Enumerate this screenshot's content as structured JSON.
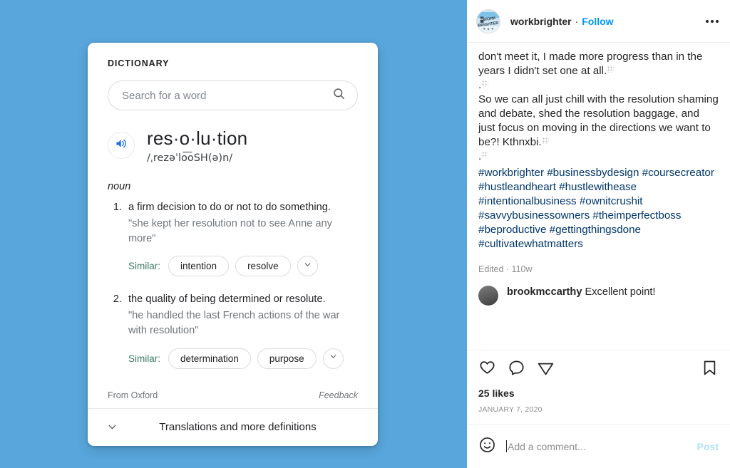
{
  "dictionary": {
    "label": "DICTIONARY",
    "search": {
      "placeholder": "Search for a word",
      "icon": "search-icon",
      "value": ""
    },
    "speaker_icon": "speaker-icon",
    "headword": "res·o·lu·tion",
    "phonetic": "/ˌrezəˈlo͞oSH(ə)n/",
    "part_of_speech": "noun",
    "senses": [
      {
        "number": "1.",
        "definition": "a firm decision to do or not to do something.",
        "example": "\"she kept her resolution not to see Anne any more\"",
        "similar_label": "Similar:",
        "similar": [
          "intention",
          "resolve"
        ],
        "expand_icon": "chevron-down-icon"
      },
      {
        "number": "2.",
        "definition": "the quality of being determined or resolute.",
        "example": "\"he handled the last French actions of the war with resolution\"",
        "similar_label": "Similar:",
        "similar": [
          "determination",
          "purpose"
        ],
        "expand_icon": "chevron-down-icon"
      }
    ],
    "source": "From Oxford",
    "feedback": "Feedback",
    "translations_label": "Translations and more definitions",
    "translations_icon": "chevron-down-icon"
  },
  "instagram": {
    "header": {
      "avatar_alt": "workbrighter",
      "avatar_line1": "WORK",
      "avatar_line2": "BRIGHTER",
      "username": "workbrighter",
      "separator": "·",
      "follow_label": "Follow",
      "more_icon": "ellipsis-icon"
    },
    "caption": {
      "paragraph_1": "don't meet it, I made more progress than in the years I didn't set one at all.",
      "paragraph_2": ".",
      "paragraph_3": "So we can all just chill with the resolution shaming and debate, shed the resolution baggage, and just focus on moving in the directions we want to be?! Kthnxbi.",
      "paragraph_4": ".",
      "hashtags": "#workbrighter #businessbydesign #coursecreator #hustleandheart #hustlewithease #intentionalbusiness #ownitcrushit #savvybusinessowners #theimperfectboss #beproductive #gettingthingsdone #cultivatewhatmatters",
      "edited": "Edited · 110w"
    },
    "top_comment": {
      "username": "brookmccarthy",
      "text": "Excellent point!"
    },
    "actions": {
      "like_icon": "heart-icon",
      "comment_icon": "comment-bubble-icon",
      "share_icon": "share-paper-plane-icon",
      "save_icon": "bookmark-icon"
    },
    "likes": "25 likes",
    "date": "JANUARY 7, 2020",
    "add_comment": {
      "emoji_icon": "emoji-smiley-icon",
      "placeholder": "Add a comment...",
      "value": "",
      "post_label": "Post"
    }
  },
  "colors": {
    "panel_blue": "#58a6dc",
    "ig_link_blue": "#0095f6",
    "hashtag_navy": "#00376b",
    "post_disabled": "#b2dffc",
    "similar_green": "#3c7a62"
  }
}
